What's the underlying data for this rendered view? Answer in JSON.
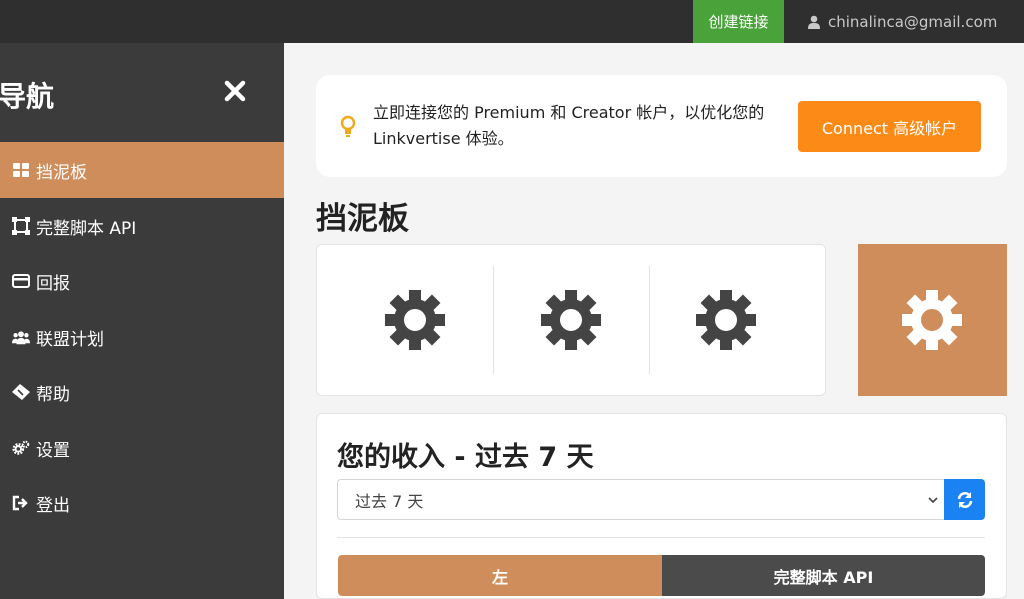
{
  "topbar": {
    "create_link": "创建链接",
    "user_email": "chinalinca@gmail.com"
  },
  "sidebar": {
    "title": "导航",
    "items": [
      {
        "label": "挡泥板",
        "icon": "grid-icon",
        "active": true
      },
      {
        "label": "完整脚本 API",
        "icon": "crop-icon",
        "active": false
      },
      {
        "label": "回报",
        "icon": "credit-card-icon",
        "active": false
      },
      {
        "label": "联盟计划",
        "icon": "users-icon",
        "active": false
      },
      {
        "label": "帮助",
        "icon": "ticket-icon",
        "active": false
      },
      {
        "label": "设置",
        "icon": "cogs-icon",
        "active": false
      },
      {
        "label": "登出",
        "icon": "sign-out-icon",
        "active": false
      }
    ]
  },
  "alert": {
    "text": "立即连接您的 Premium 和 Creator 帐户，以优化您的 Linkvertise 体验。",
    "button": "Connect 高级帐户"
  },
  "main": {
    "title": "挡泥板"
  },
  "income": {
    "title": "您的收入 - 过去 7 天",
    "range_value": "过去 7 天",
    "tab_left": "左",
    "tab_right": "完整脚本 API"
  },
  "colors": {
    "accent": "#cf8d5c",
    "create_link": "#4aa33a",
    "connect_button": "#fb8a17",
    "refresh_button": "#1b82f3",
    "sidebar": "#3b3b3b",
    "topbar": "#2f2f2f"
  }
}
